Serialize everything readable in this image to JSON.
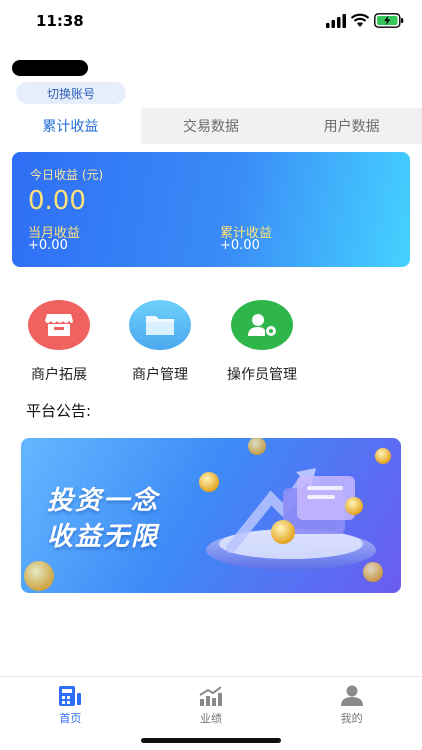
{
  "status_bar": {
    "time": "11:38"
  },
  "account": {
    "switch_label": "切换账号"
  },
  "tabs": [
    {
      "label": "累计收益",
      "active": true
    },
    {
      "label": "交易数据",
      "active": false
    },
    {
      "label": "用户数据",
      "active": false
    }
  ],
  "earnings": {
    "today_label": "今日收益 (元)",
    "today_value": "0.00",
    "month_label": "当月收益",
    "month_value": "+0.00",
    "total_label": "累计收益",
    "total_value": "+0.00"
  },
  "features": [
    {
      "label": "商户拓展",
      "icon": "store-icon",
      "color": "#f0625f"
    },
    {
      "label": "商户管理",
      "icon": "folder-icon",
      "color": "#5bbcf4"
    },
    {
      "label": "操作员管理",
      "icon": "operator-settings-icon",
      "color": "#2fb64a"
    }
  ],
  "notice": {
    "title": "平台公告:"
  },
  "banner": {
    "line1": "投资一念",
    "line2": "收益无限"
  },
  "bottom_nav": [
    {
      "label": "首页",
      "icon": "home-calculator-icon",
      "active": true
    },
    {
      "label": "业绩",
      "icon": "chart-icon",
      "active": false
    },
    {
      "label": "我的",
      "icon": "profile-icon",
      "active": false
    }
  ],
  "colors": {
    "accent": "#2f6ef5",
    "tab_active": "#1f6fd8",
    "highlight": "#ffe17a"
  }
}
